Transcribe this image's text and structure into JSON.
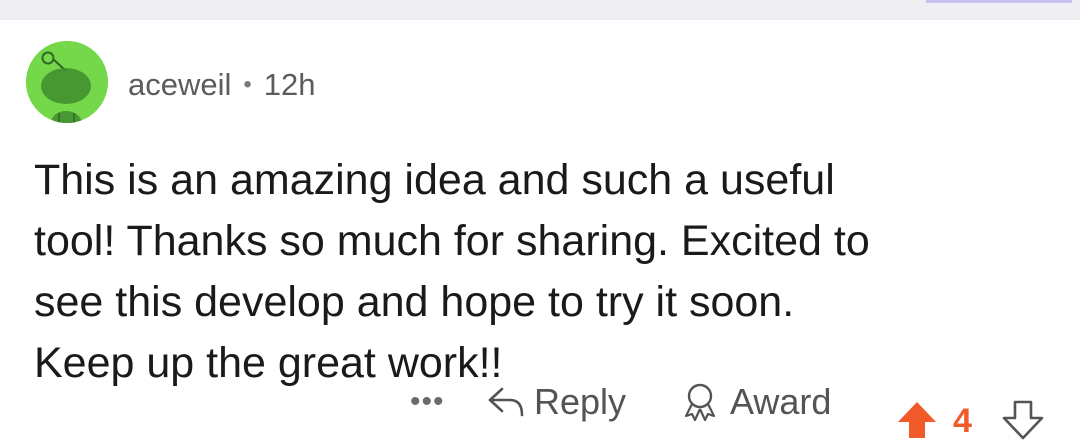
{
  "comment": {
    "username": "aceweil",
    "separator": "•",
    "time_ago": "12h",
    "text": "This is an amazing idea and such a useful\ntool!  Thanks so much for sharing.  Excited to\nsee this develop and hope to try it soon.\nKeep up the great work!!",
    "avatar_icon": "snoo-avatar-icon",
    "avatar_color": "#74d84a"
  },
  "actions": {
    "more_label": "•••",
    "reply_label": "Reply",
    "award_label": "Award",
    "vote_count": "4",
    "upvote_color": "#f15b2a"
  }
}
